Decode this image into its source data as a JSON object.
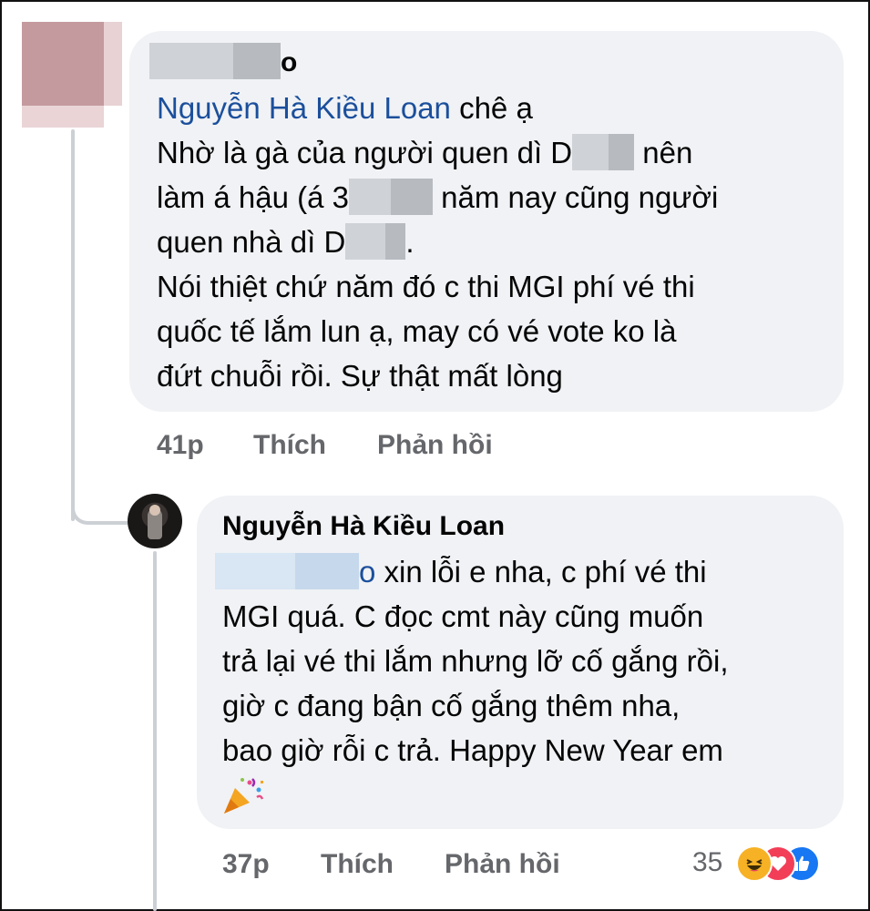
{
  "comment1": {
    "author_suffix": "o",
    "mention": "Nguyễn Hà Kiều Loan",
    "line1_after_mention": " chê ạ",
    "line2_a": "Nhờ là gà của người quen dì D",
    "line2_b": " nên",
    "line3_a": "làm á hậu (á 3",
    "line3_b": " năm nay cũng người",
    "line4_a": "quen nhà dì D",
    "line4_b": ".",
    "line5": "Nói thiệt chứ năm đó c thi MGI phí vé thi",
    "line6": "quốc tế lắm lun ạ, may có vé vote ko là",
    "line7": "đứt chuỗi rồi. Sự thật mất lòng",
    "time": "41p",
    "like_label": "Thích",
    "reply_label": "Phản hồi"
  },
  "comment2": {
    "author": "Nguyễn Hà Kiều Loan",
    "line1_suffix": "o",
    "line1_rest": " xin lỗi e nha, c phí vé thi",
    "line2": "MGI quá. C đọc cmt này cũng muốn",
    "line3": "trả lại vé thi lắm nhưng lỡ cố gắng rồi,",
    "line4": "giờ c đang bận cố gắng thêm nha,",
    "line5": "bao giờ rỗi c trả. Happy New Year em",
    "time": "37p",
    "like_label": "Thích",
    "reply_label": "Phản hồi",
    "reaction_count": "35",
    "reactions": [
      "haha-icon",
      "love-icon",
      "like-icon"
    ]
  },
  "colors": {
    "bubble": "#f0f2f5",
    "mention": "#1b4f9c",
    "meta": "#65676b"
  }
}
